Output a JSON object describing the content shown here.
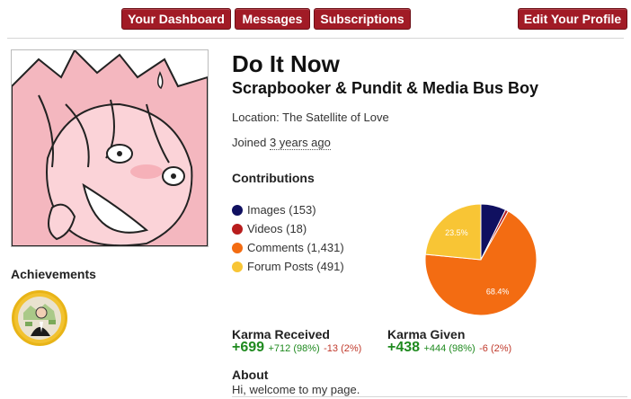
{
  "nav": {
    "dashboard": "Your Dashboard",
    "messages": "Messages",
    "subscriptions": "Subscriptions",
    "edit_profile": "Edit Your Profile"
  },
  "profile": {
    "name": "Do It Now",
    "title": "Scrapbooker & Pundit & Media Bus Boy",
    "location_label": "Location:",
    "location_value": "The Satellite of Love",
    "joined_label": "Joined",
    "joined_value": "3 years ago"
  },
  "achievements": {
    "heading": "Achievements"
  },
  "contributions": {
    "heading": "Contributions",
    "items": [
      {
        "label": "Images (153)",
        "color": "#101060"
      },
      {
        "label": "Videos (18)",
        "color": "#b81d1d"
      },
      {
        "label": "Comments (1,431)",
        "color": "#f36c12"
      },
      {
        "label": "Forum Posts (491)",
        "color": "#f8c535"
      }
    ]
  },
  "chart_data": {
    "type": "pie",
    "labels": [
      "Images",
      "Videos",
      "Comments",
      "Forum Posts"
    ],
    "values": [
      153,
      18,
      1431,
      491
    ],
    "colors": [
      "#101060",
      "#b81d1d",
      "#f36c12",
      "#f8c535"
    ],
    "data_labels": [
      "",
      "",
      "68.4%",
      "23.5%"
    ]
  },
  "karma": {
    "received": {
      "label": "Karma Received",
      "total": "+699",
      "up": "+712 (98%)",
      "down": "-13 (2%)"
    },
    "given": {
      "label": "Karma Given",
      "total": "+438",
      "up": "+444 (98%)",
      "down": "-6 (2%)"
    }
  },
  "about": {
    "heading": "About",
    "text": "Hi, welcome to my page."
  }
}
